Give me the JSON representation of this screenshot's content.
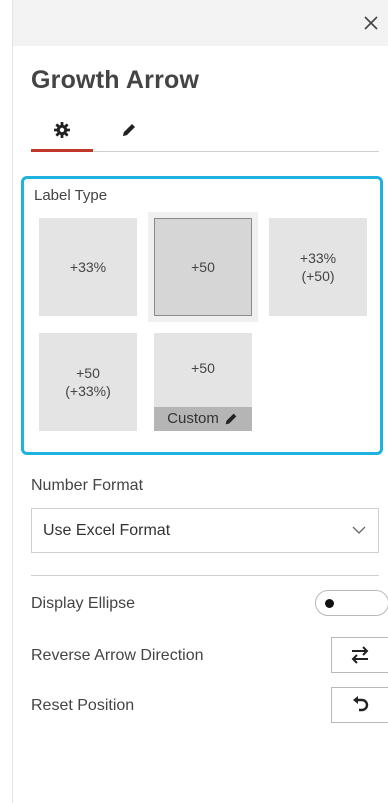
{
  "header": {
    "title": "Growth Arrow"
  },
  "tabs": [
    {
      "name": "settings"
    },
    {
      "name": "edit"
    }
  ],
  "label_type": {
    "title": "Label Type",
    "options": [
      {
        "line1": "+33%",
        "line2": ""
      },
      {
        "line1": "+50",
        "line2": ""
      },
      {
        "line1": "+33%",
        "line2": "(+50)"
      },
      {
        "line1": "+50",
        "line2": "(+33%)"
      },
      {
        "line1": "+50",
        "custom_label": "Custom"
      }
    ],
    "selected_index": 1
  },
  "number_format": {
    "label": "Number Format",
    "value": "Use Excel Format"
  },
  "display_ellipse": {
    "label": "Display Ellipse",
    "on": false
  },
  "reverse_arrow": {
    "label": "Reverse Arrow Direction"
  },
  "reset_position": {
    "label": "Reset Position"
  },
  "colors": {
    "accent_tab": "#c0392b",
    "highlight_border": "#1fb2e0",
    "tile_bg": "#e4e4e4"
  }
}
